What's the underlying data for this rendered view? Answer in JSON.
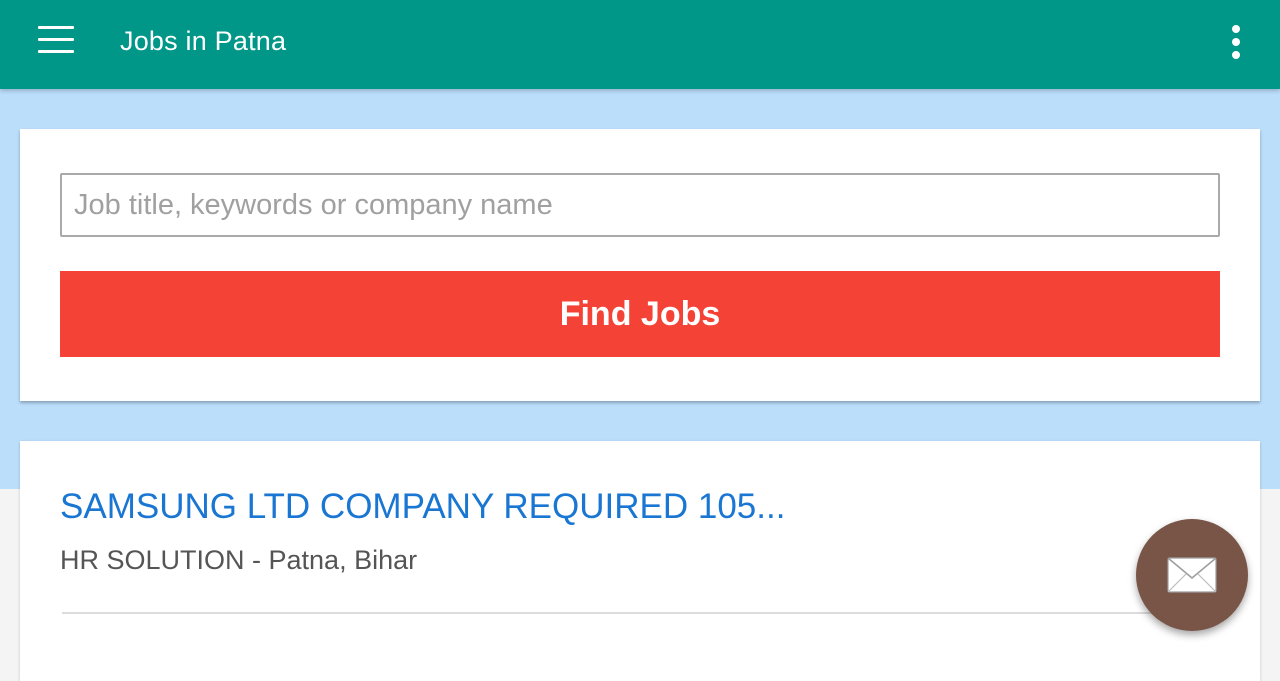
{
  "appbar": {
    "title": "Jobs in Patna",
    "menu_icon": "hamburger-menu-icon",
    "overflow_icon": "more-vert-icon",
    "color": "#009688"
  },
  "search": {
    "value": "",
    "placeholder": "Job title, keywords or company name",
    "button_label": "Find Jobs",
    "button_color": "#f44336"
  },
  "jobs": [
    {
      "title": "SAMSUNG LTD COMPANY REQUIRED 105...",
      "meta": "HR SOLUTION - Patna, Bihar"
    }
  ],
  "fab": {
    "icon": "email-icon",
    "color": "#795548"
  },
  "colors": {
    "band": "#bbdefb",
    "job_title": "#1976d2"
  }
}
